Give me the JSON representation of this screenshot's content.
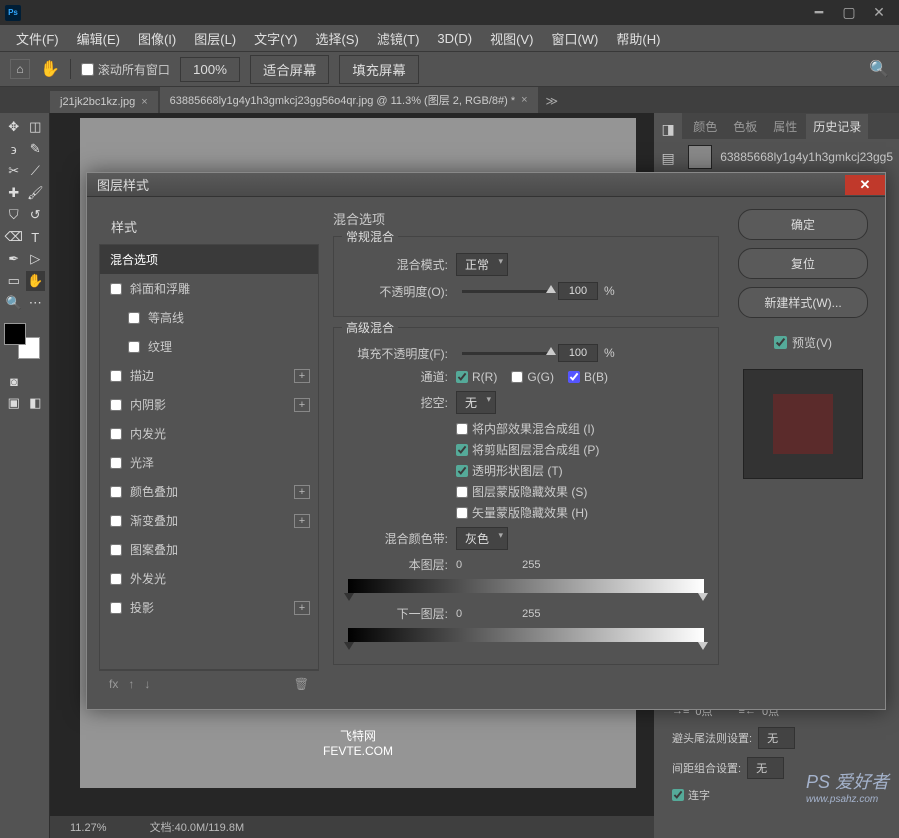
{
  "menu": {
    "file": "文件(F)",
    "edit": "编辑(E)",
    "image": "图像(I)",
    "layer": "图层(L)",
    "type": "文字(Y)",
    "select": "选择(S)",
    "filter": "滤镜(T)",
    "threeD": "3D(D)",
    "view": "视图(V)",
    "window": "窗口(W)",
    "help": "帮助(H)"
  },
  "opt": {
    "scroll_all": "滚动所有窗口",
    "zoom100": "100%",
    "fit_screen": "适合屏幕",
    "fill_screen": "填充屏幕"
  },
  "tabs": {
    "t1": "j21jk2bc1kz.jpg",
    "t2": "63885668ly1g4y1h3gmkcj23gg56o4qr.jpg @ 11.3% (图层 2, RGB/8#) *"
  },
  "panels": {
    "color": "颜色",
    "swatch": "色板",
    "props": "属性",
    "history": "历史记录"
  },
  "history_file": "63885668ly1g4y1h3gmkcj23gg5",
  "dialog": {
    "title": "图层样式",
    "styles_header": "样式",
    "items": {
      "blend_opts": "混合选项",
      "bevel": "斜面和浮雕",
      "contour": "等高线",
      "texture": "纹理",
      "stroke": "描边",
      "inner_shadow": "内阴影",
      "inner_glow": "内发光",
      "satin": "光泽",
      "color_overlay": "颜色叠加",
      "grad_overlay": "渐变叠加",
      "pattern_overlay": "图案叠加",
      "outer_glow": "外发光",
      "drop_shadow": "投影"
    },
    "blend_legend": "混合选项",
    "normal_legend": "常规混合",
    "mode_label": "混合模式:",
    "mode_value": "正常",
    "opacity_label": "不透明度(O):",
    "opacity_value": "100",
    "pct": "%",
    "adv_legend": "高级混合",
    "fill_label": "填充不透明度(F):",
    "fill_value": "100",
    "channels_label": "通道:",
    "ch_r": "R(R)",
    "ch_g": "G(G)",
    "ch_b": "B(B)",
    "knockout_label": "挖空:",
    "knockout_value": "无",
    "c1": "将内部效果混合成组 (I)",
    "c2": "将剪贴图层混合成组 (P)",
    "c3": "透明形状图层 (T)",
    "c4": "图层蒙版隐藏效果 (S)",
    "c5": "矢量蒙版隐藏效果 (H)",
    "blendif_label": "混合颜色带:",
    "blendif_value": "灰色",
    "this_layer": "本图层:",
    "under_layer": "下一图层:",
    "v0": "0",
    "v255": "255",
    "ok": "确定",
    "reset": "复位",
    "new_style": "新建样式(W)...",
    "preview": "预览(V)"
  },
  "status": {
    "zoom": "11.27%",
    "doc": "文档:40.0M/119.8M"
  },
  "watermark": {
    "l1": "飞特网",
    "l2": "FEVTE.COM",
    "ps": "PS 爱好者",
    "psurl": "www.psahz.com"
  },
  "para": {
    "indent_first": "0点",
    "indent_after": "0点",
    "avoid": "避头尾法则设置:",
    "none": "无",
    "spacing": "间距组合设置:",
    "hyphen": "连字"
  }
}
